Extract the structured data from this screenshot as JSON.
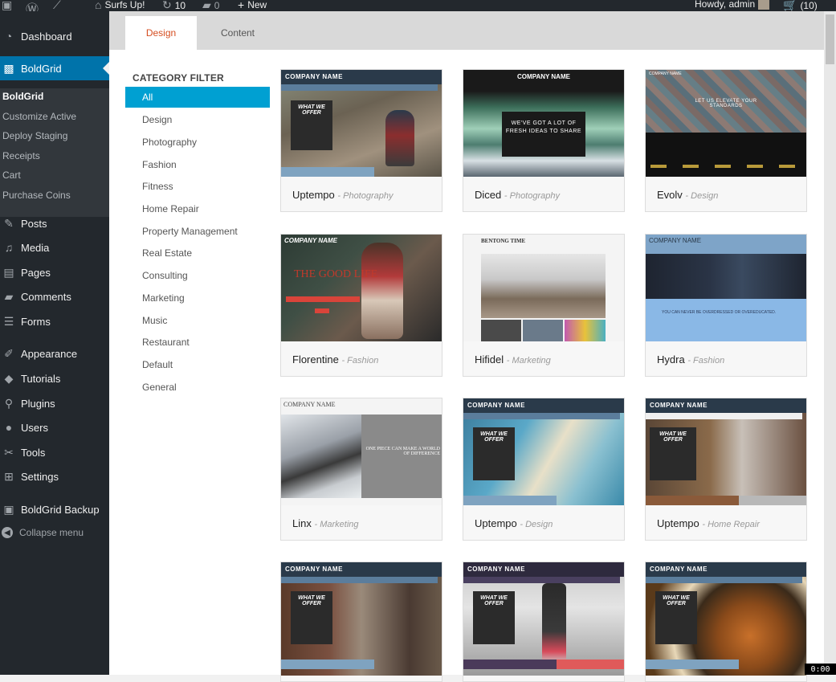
{
  "adminbar": {
    "site_name": "Surfs Up!",
    "updates_count": "10",
    "comments_count": "0",
    "new_label": "New",
    "howdy": "Howdy, admin",
    "cart_count": "(10)"
  },
  "sidebar": {
    "dashboard": "Dashboard",
    "boldgrid": "BoldGrid",
    "submenu": [
      "BoldGrid",
      "Customize Active",
      "Deploy Staging",
      "Receipts",
      "Cart",
      "Purchase Coins"
    ],
    "posts": "Posts",
    "media": "Media",
    "pages": "Pages",
    "comments": "Comments",
    "forms": "Forms",
    "appearance": "Appearance",
    "tutorials": "Tutorials",
    "plugins": "Plugins",
    "users": "Users",
    "tools": "Tools",
    "settings": "Settings",
    "backup": "BoldGrid Backup",
    "collapse": "Collapse menu"
  },
  "tabs": {
    "design": "Design",
    "content": "Content"
  },
  "filter": {
    "title": "CATEGORY FILTER",
    "categories": [
      "All",
      "Design",
      "Photography",
      "Fashion",
      "Fitness",
      "Home Repair",
      "Property Management",
      "Real Estate",
      "Consulting",
      "Marketing",
      "Music",
      "Restaurant",
      "Default",
      "General"
    ]
  },
  "thumbs": {
    "company": "COMPANY NAME",
    "company_serif": "COMPANY NAME",
    "what_we_offer": "WHAT WE OFFER",
    "diced_text": "WE'VE GOT A LOT OF FRESH IDEAS TO SHARE",
    "evolv_text": "LET US ELEVATE YOUR STANDARDS",
    "florentine_text": "THE GOOD LIFE",
    "hifidel_logo": "BENTONG TIME",
    "hydra_text": "YOU CAN NEVER BE OVERDRESSED OR OVEREDUCATED.",
    "linx_text": "ONE PIECE CAN MAKE A WORLD OF DIFFERENCE"
  },
  "themes": [
    {
      "name": "Uptempo",
      "category": "Photography"
    },
    {
      "name": "Diced",
      "category": "Photography"
    },
    {
      "name": "Evolv",
      "category": "Design"
    },
    {
      "name": "Florentine",
      "category": "Fashion"
    },
    {
      "name": "Hifidel",
      "category": "Marketing"
    },
    {
      "name": "Hydra",
      "category": "Fashion"
    },
    {
      "name": "Linx",
      "category": "Marketing"
    },
    {
      "name": "Uptempo",
      "category": "Design"
    },
    {
      "name": "Uptempo",
      "category": "Home Repair"
    }
  ],
  "overlay": "0:00"
}
